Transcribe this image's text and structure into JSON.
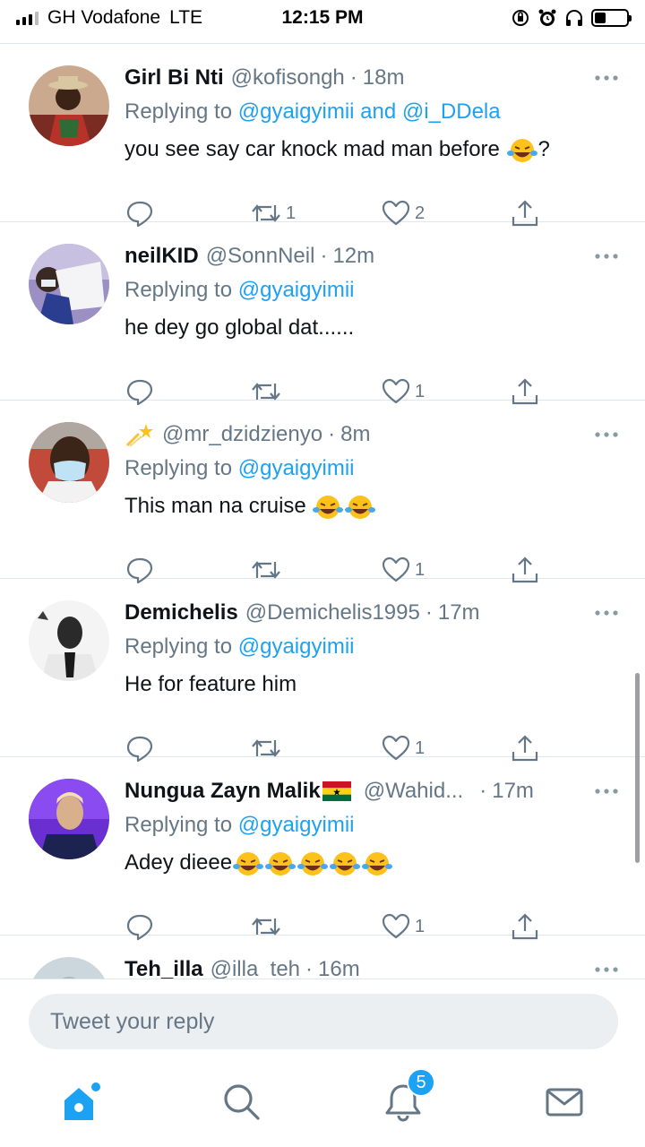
{
  "status": {
    "carrier": "GH Vodafone",
    "network": "LTE",
    "time": "12:15 PM"
  },
  "tweets": [
    {
      "name": "Girl Bi Nti",
      "handle": "@kofisongh",
      "time": "18m",
      "replying_prefix": "Replying to ",
      "mentions": [
        "@gyaigyimii",
        "@i_DDela"
      ],
      "mention_joiner": " and ",
      "text": "you see say car knock mad man before",
      "text_suffix": "?",
      "emoji_count": 1,
      "retweets": "1",
      "likes": "2"
    },
    {
      "name": "neilKID",
      "handle": "@SonnNeil",
      "time": "12m",
      "replying_prefix": "Replying to ",
      "mentions": [
        "@gyaigyimii"
      ],
      "text": "he dey go global dat......",
      "emoji_count": 0,
      "retweets": "",
      "likes": "1"
    },
    {
      "name": "",
      "handle": "@mr_dzidzienyo",
      "time": "8m",
      "replying_prefix": "Replying to ",
      "mentions": [
        "@gyaigyimii"
      ],
      "text": "This man na cruise",
      "emoji_count": 2,
      "retweets": "",
      "likes": "1"
    },
    {
      "name": "Demichelis",
      "handle": "@Demichelis1995",
      "time": "17m",
      "replying_prefix": "Replying to ",
      "mentions": [
        "@gyaigyimii"
      ],
      "text": "He for feature him",
      "emoji_count": 0,
      "retweets": "",
      "likes": "1"
    },
    {
      "name": "Nungua Zayn Malik",
      "handle": "@Wahid...",
      "time": "17m",
      "replying_prefix": "Replying to ",
      "mentions": [
        "@gyaigyimii"
      ],
      "text": "Adey dieee",
      "emoji_count": 5,
      "retweets": "",
      "likes": "1"
    },
    {
      "name": "Teh_illa",
      "handle": "@illa_teh",
      "time": "16m"
    }
  ],
  "compose": {
    "placeholder": "Tweet your reply"
  },
  "tabbar": {
    "notifications_badge": "5"
  },
  "colors": {
    "accent": "#1da1f2",
    "muted": "#657786",
    "divider": "#e1e8ed"
  }
}
